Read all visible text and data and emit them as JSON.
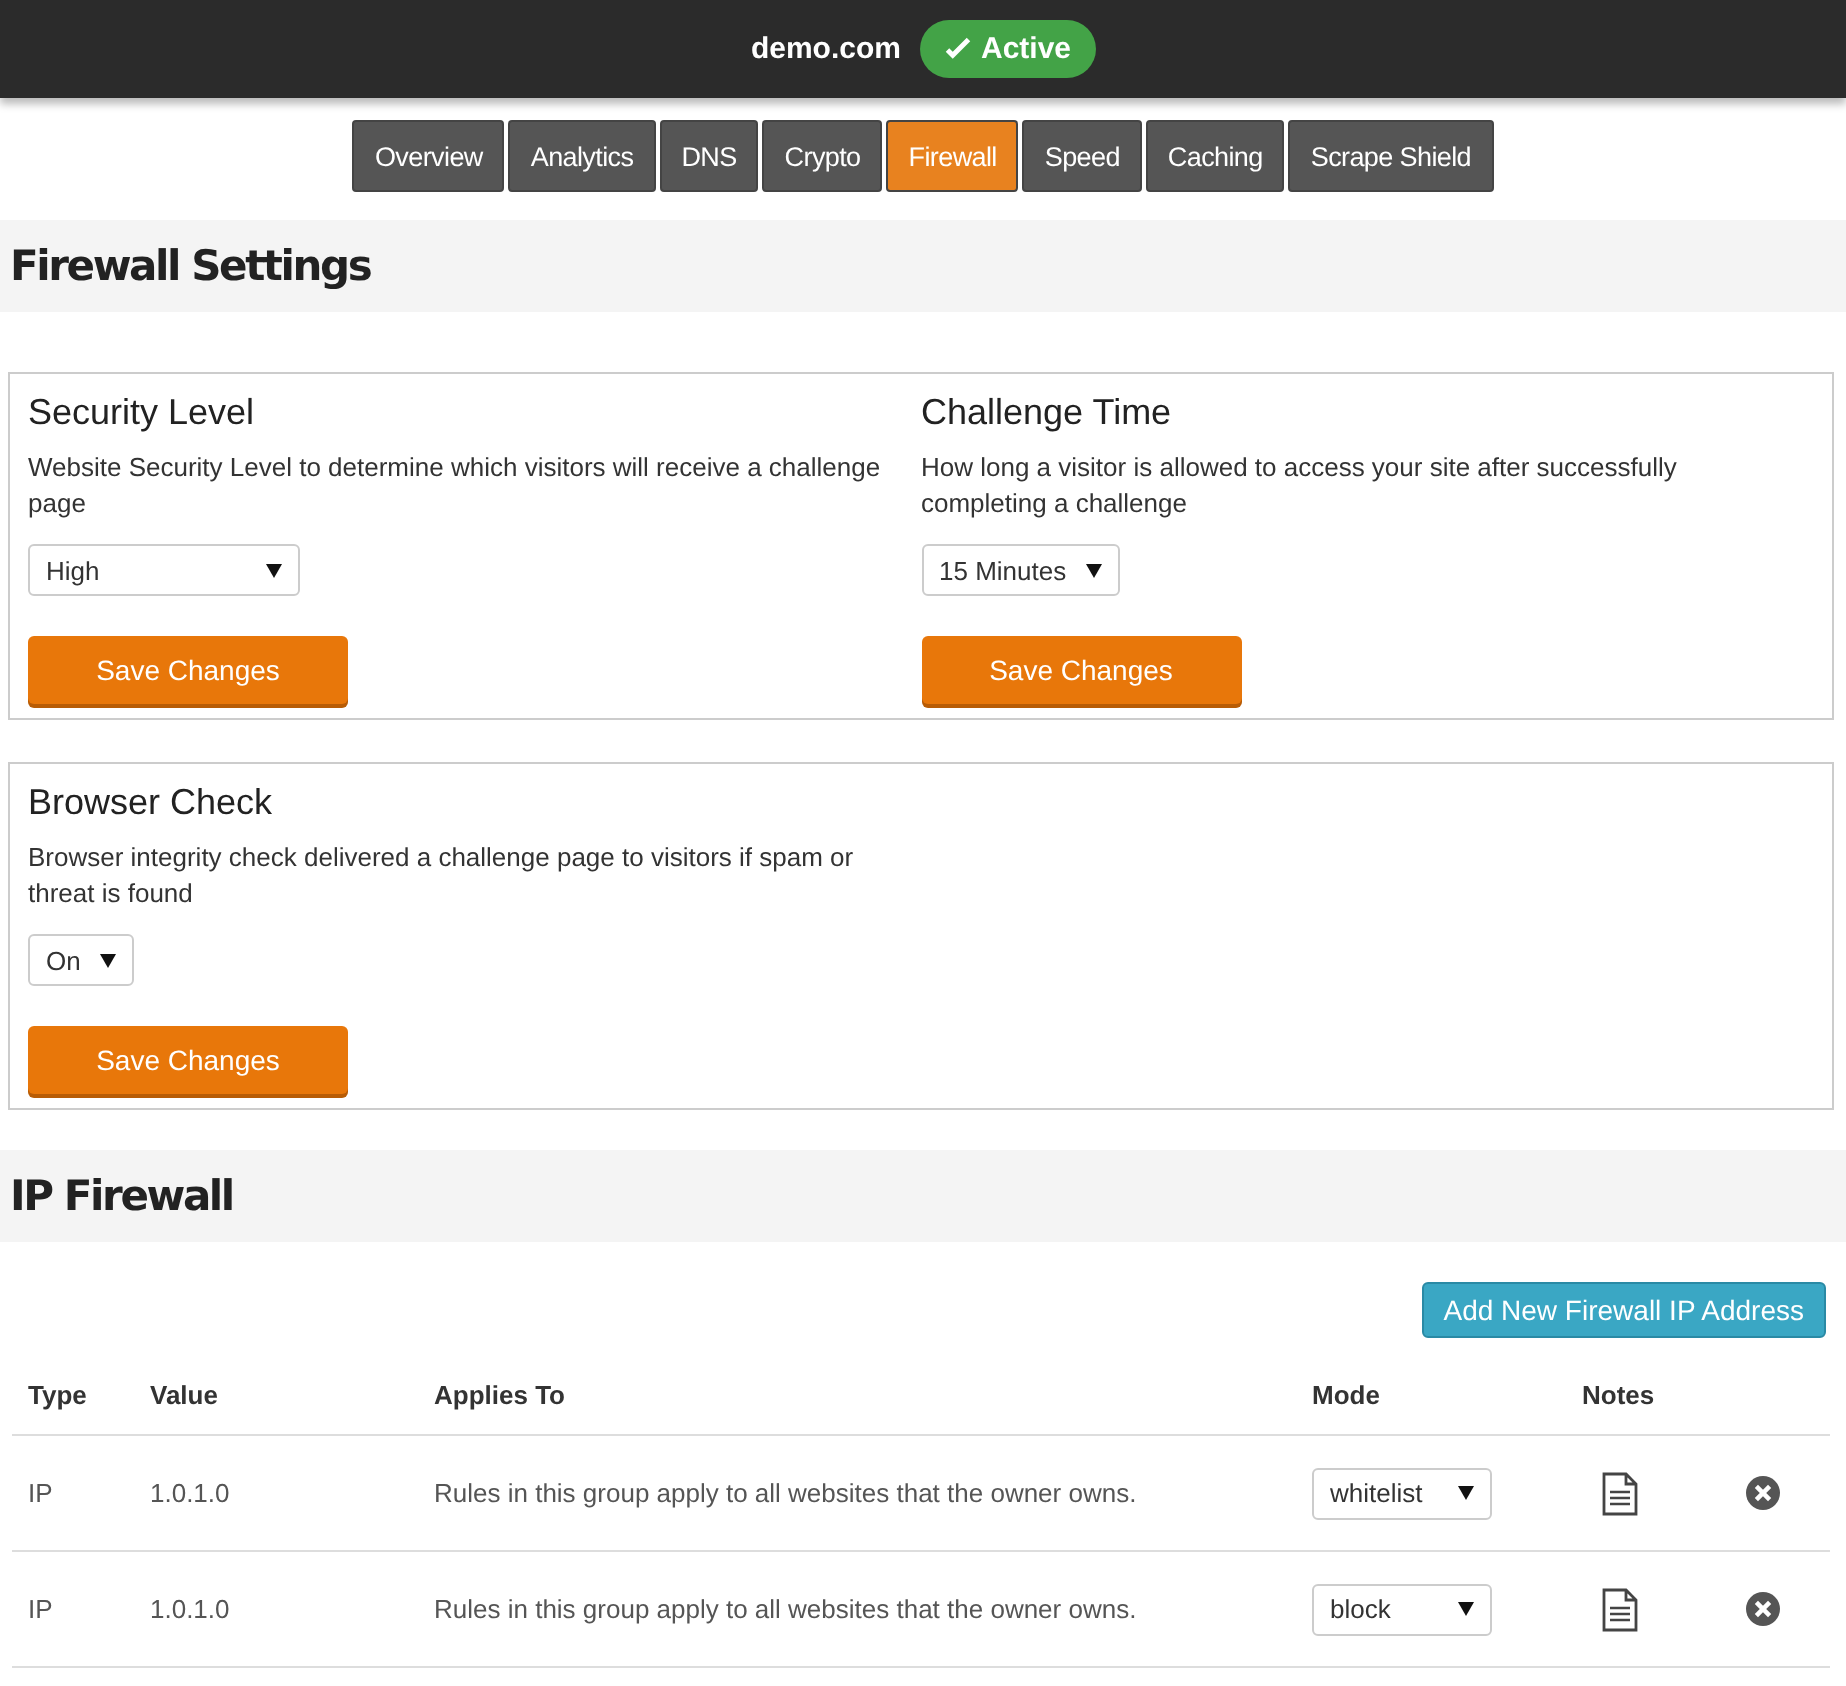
{
  "header": {
    "domain": "demo.com",
    "status": {
      "label": "Active",
      "active": true
    }
  },
  "tabs": [
    {
      "label": "Overview",
      "selected": false
    },
    {
      "label": "Analytics",
      "selected": false
    },
    {
      "label": "DNS",
      "selected": false
    },
    {
      "label": "Crypto",
      "selected": false
    },
    {
      "label": "Firewall",
      "selected": true
    },
    {
      "label": "Speed",
      "selected": false
    },
    {
      "label": "Caching",
      "selected": false
    },
    {
      "label": "Scrape Shield",
      "selected": false
    }
  ],
  "firewall_settings": {
    "title": "Firewall Settings",
    "cards": [
      [
        {
          "title": "Security Level",
          "description": "Website Security Level to determine which visitors will receive a challenge page",
          "select": "High",
          "button": "Save Changes"
        },
        {
          "title": "Challenge Time",
          "description": "How long a visitor is allowed to access your site after successfully completing a challenge",
          "select": "15 Minutes",
          "button": "Save Changes"
        }
      ],
      [
        {
          "title": "Browser Check",
          "description": "Browser integrity check delivered a challenge page to visitors if spam or threat is found",
          "select": "On",
          "button": "Save Changes"
        }
      ]
    ]
  },
  "ip_firewall": {
    "title": "IP Firewall",
    "add_button": "Add New Firewall IP Address",
    "columns": [
      "Type",
      "Value",
      "Applies To",
      "Mode",
      "Notes"
    ],
    "rows": [
      {
        "type": "IP",
        "value": "1.0.1.0",
        "applies_to": "Rules in this group apply to all websites that the owner owns.",
        "mode": "whitelist"
      },
      {
        "type": "IP",
        "value": "1.0.1.0",
        "applies_to": "Rules in this group apply to all websites that the owner owns.",
        "mode": "block"
      }
    ]
  }
}
